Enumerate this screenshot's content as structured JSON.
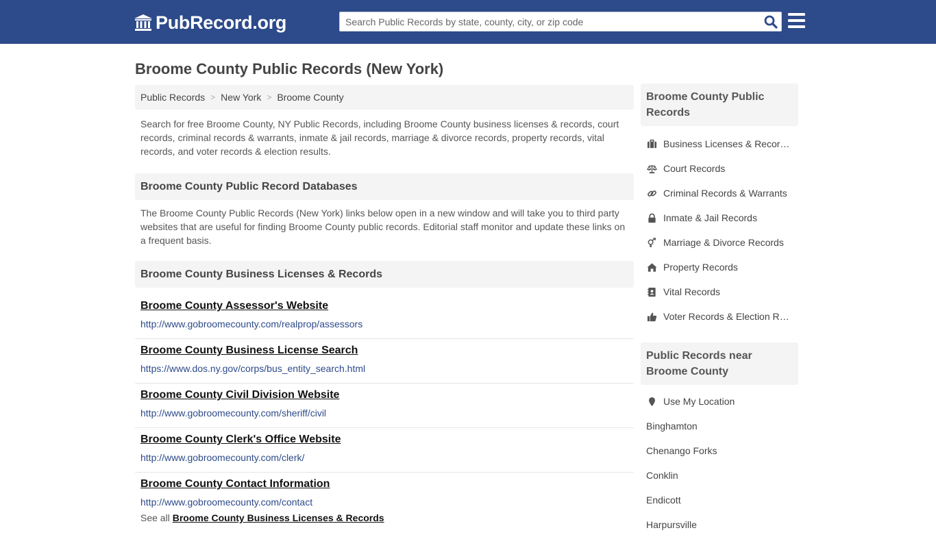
{
  "header": {
    "logo_text": "PubRecord.org",
    "search_placeholder": "Search Public Records by state, county, city, or zip code"
  },
  "page_title": "Broome County Public Records (New York)",
  "breadcrumb": [
    "Public Records",
    "New York",
    "Broome County"
  ],
  "intro": "Search for free Broome County, NY Public Records, including Broome County business licenses & records, court records, criminal records & warrants, inmate & jail records, marriage & divorce records, property records, vital records, and voter records & election results.",
  "databases_heading": "Broome County Public Record Databases",
  "databases_note": "The Broome County Public Records (New York) links below open in a new window and will take you to third party websites that are useful for finding Broome County public records. Editorial staff monitor and update these links on a frequent basis.",
  "business_heading": "Broome County Business Licenses & Records",
  "records": [
    {
      "title": "Broome County Assessor's Website",
      "url": "http://www.gobroomecounty.com/realprop/assessors"
    },
    {
      "title": "Broome County Business License Search",
      "url": "https://www.dos.ny.gov/corps/bus_entity_search.html"
    },
    {
      "title": "Broome County Civil Division Website",
      "url": "http://www.gobroomecounty.com/sheriff/civil"
    },
    {
      "title": "Broome County Clerk's Office Website",
      "url": "http://www.gobroomecounty.com/clerk/"
    },
    {
      "title": "Broome County Contact Information",
      "url": "http://www.gobroomecounty.com/contact"
    }
  ],
  "see_all": {
    "prefix": "See all ",
    "link": "Broome County Business Licenses & Records"
  },
  "sidebar": {
    "heading1": "Broome County Public Records",
    "categories": [
      {
        "icon": "briefcase-icon",
        "label": "Business Licenses & Records"
      },
      {
        "icon": "balance-scale-icon",
        "label": "Court Records"
      },
      {
        "icon": "link-icon",
        "label": "Criminal Records & Warrants"
      },
      {
        "icon": "lock-icon",
        "label": "Inmate & Jail Records"
      },
      {
        "icon": "venus-mars-icon",
        "label": "Marriage & Divorce Records"
      },
      {
        "icon": "home-icon",
        "label": "Property Records"
      },
      {
        "icon": "address-book-icon",
        "label": "Vital Records"
      },
      {
        "icon": "thumbs-up-icon",
        "label": "Voter Records & Election Results"
      }
    ],
    "heading2": "Public Records near Broome County",
    "location_label": "Use My Location",
    "nearby": [
      "Binghamton",
      "Chenango Forks",
      "Conklin",
      "Endicott",
      "Harpursville"
    ]
  },
  "colors": {
    "nav": "#2d4a8a",
    "link": "#2d4a8a",
    "panel": "#f4f4f4"
  }
}
